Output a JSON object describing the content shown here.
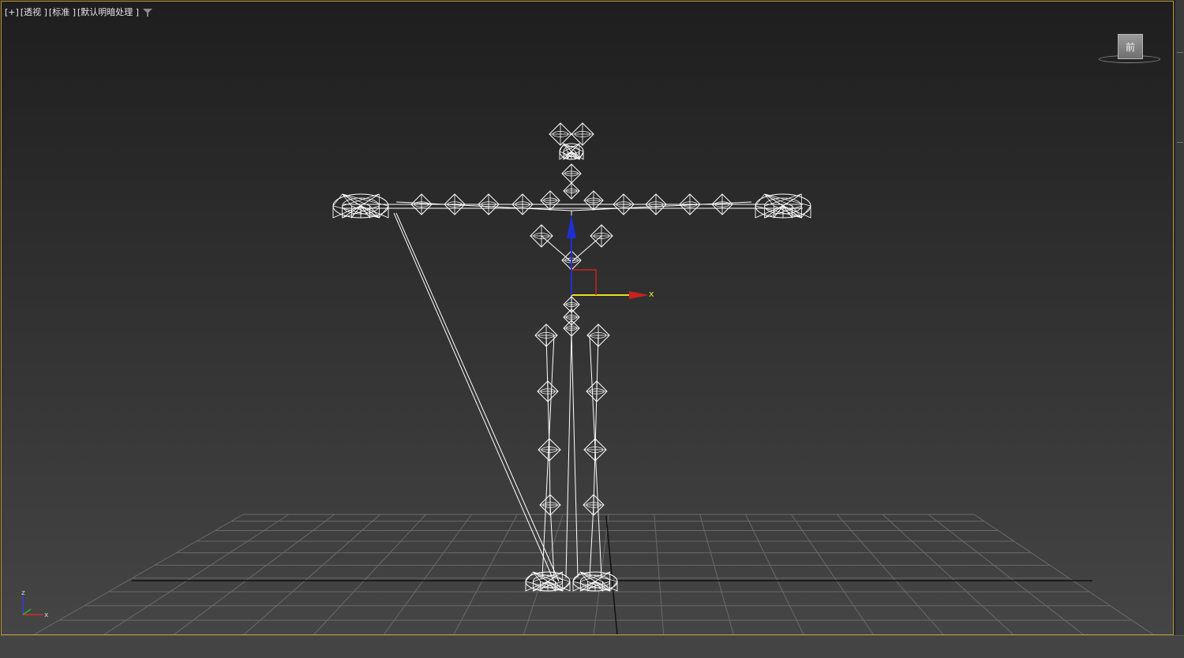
{
  "viewport": {
    "menu_plus": "[+]",
    "view_mode": "[透视 ]",
    "shading_mode": "[标准 ]",
    "lighting_mode": "[默认明暗处理 ]",
    "filter_icon": "filter-funnel-icon"
  },
  "viewcube": {
    "face_label": "前"
  },
  "transform_gizmo": {
    "x_label": "x"
  },
  "axis_tripod": {
    "z_label": "z",
    "x_label": "x"
  },
  "colors": {
    "viewport_border": "#b8962e",
    "bones": "#ffffff",
    "axis_x": "#cc2020",
    "axis_y": "#e0d000",
    "axis_z": "#2030d0",
    "grid": "#6a6a6a"
  }
}
